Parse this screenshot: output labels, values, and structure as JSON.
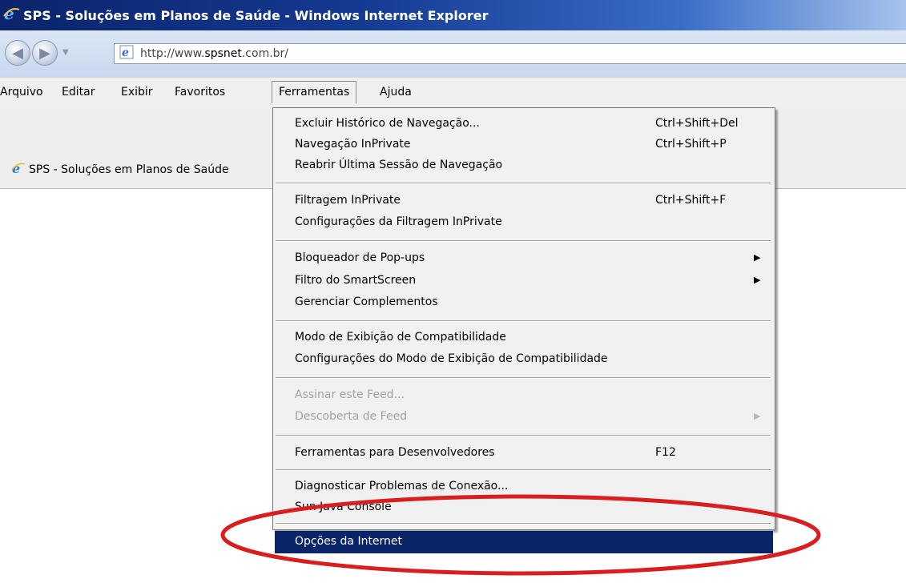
{
  "window": {
    "title": "SPS - Soluções em Planos de Saúde - Windows Internet Explorer"
  },
  "address_bar": {
    "url_prefix": "http://www.",
    "url_domain": "spsnet",
    "url_suffix": ".com.br/"
  },
  "menubar": {
    "items": [
      {
        "label": "Arquivo"
      },
      {
        "label": "Editar"
      },
      {
        "label": "Exibir"
      },
      {
        "label": "Favoritos"
      },
      {
        "label": "Ferramentas"
      },
      {
        "label": "Ajuda"
      }
    ],
    "active_item": "Ferramentas"
  },
  "tab": {
    "title": "SPS - Soluções em Planos de Saúde"
  },
  "tools_menu": {
    "items": [
      {
        "label": "Excluir Histórico de Navegação...",
        "shortcut": "Ctrl+Shift+Del"
      },
      {
        "label": "Navegação InPrivate",
        "shortcut": "Ctrl+Shift+P"
      },
      {
        "label": "Reabrir Última Sessão de Navegação"
      },
      {
        "label": "Filtragem InPrivate",
        "shortcut": "Ctrl+Shift+F"
      },
      {
        "label": "Configurações da Filtragem InPrivate"
      },
      {
        "label": "Bloqueador de Pop-ups",
        "submenu_arrow": "▶"
      },
      {
        "label": "Filtro do SmartScreen",
        "submenu_arrow": "▶"
      },
      {
        "label": "Gerenciar Complementos"
      },
      {
        "label": "Modo de Exibição de Compatibilidade"
      },
      {
        "label": "Configurações do Modo de Exibição de Compatibilidade"
      },
      {
        "label": "Assinar este Feed...",
        "disabled": true
      },
      {
        "label": "Descoberta de Feed",
        "submenu_arrow": "▶",
        "disabled": true
      },
      {
        "label": "Ferramentas para Desenvolvedores",
        "shortcut": "F12"
      },
      {
        "label": "Diagnosticar Problemas de Conexão..."
      },
      {
        "label": "Sun Java Console"
      },
      {
        "label": "Opções da Internet",
        "highlighted": true
      }
    ]
  },
  "colors": {
    "title_bar": "#0b246b",
    "menu_highlight": "#0a246a",
    "annotation_ellipse": "#d81e1e"
  }
}
